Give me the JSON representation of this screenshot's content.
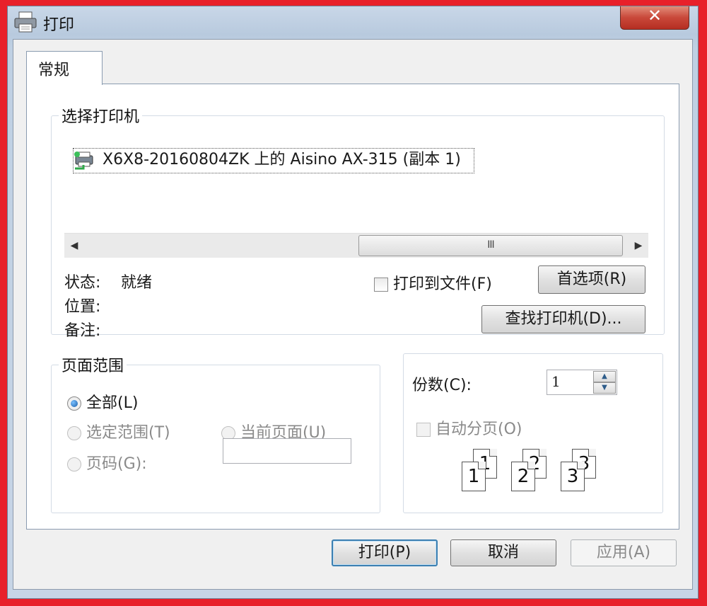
{
  "window": {
    "title": "打印",
    "close_glyph": "✕"
  },
  "tabs": [
    {
      "label": "常规"
    }
  ],
  "printer_group": {
    "legend": "选择打印机",
    "selected_printer": "X6X8-20160804ZK 上的 Aisino AX-315 (副本 1)",
    "scrollbar_thumb_glyph": "III",
    "status_label": "状态:",
    "status_value": "就绪",
    "location_label": "位置:",
    "comment_label": "备注:",
    "print_to_file_label": "打印到文件(F)",
    "preferences_button": "首选项(R)",
    "find_printer_button": "查找打印机(D)..."
  },
  "page_range": {
    "legend": "页面范围",
    "all_label": "全部(L)",
    "selection_label": "选定范围(T)",
    "current_page_label": "当前页面(U)",
    "pages_label": "页码(G):",
    "pages_value": ""
  },
  "copies": {
    "copies_label": "份数(C):",
    "copies_value": "1",
    "collate_label": "自动分页(O)",
    "collate_pages": [
      "1",
      "2",
      "3"
    ]
  },
  "footer": {
    "print_button": "打印(P)",
    "cancel_button": "取消",
    "apply_button": "应用(A)"
  }
}
